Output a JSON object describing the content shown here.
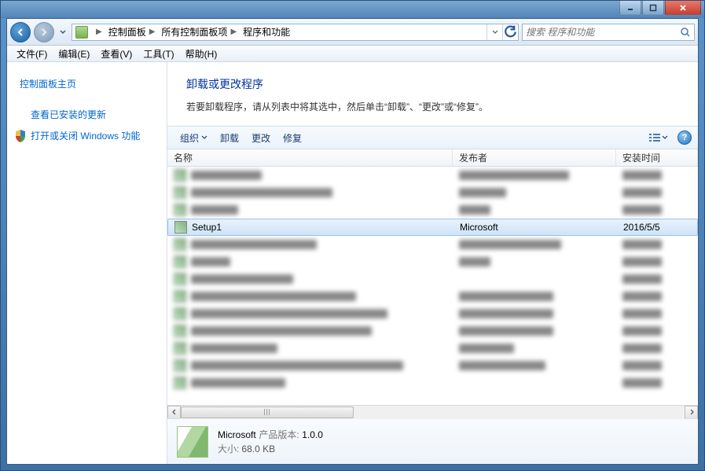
{
  "breadcrumb": {
    "root_icon_name": "control-panel",
    "items": [
      "控制面板",
      "所有控制面板项",
      "程序和功能"
    ]
  },
  "search": {
    "placeholder": "搜索 程序和功能"
  },
  "menu": {
    "file": "文件(F)",
    "edit": "编辑(E)",
    "view": "查看(V)",
    "tools": "工具(T)",
    "help": "帮助(H)"
  },
  "sidebar": {
    "home": "控制面板主页",
    "updates": "查看已安装的更新",
    "features": "打开或关闭 Windows 功能"
  },
  "heading": {
    "title": "卸载或更改程序",
    "desc": "若要卸载程序，请从列表中将其选中，然后单击“卸载”、“更改”或“修复”。"
  },
  "toolbar": {
    "organize": "组织",
    "uninstall": "卸载",
    "change": "更改",
    "repair": "修复"
  },
  "columns": {
    "name": "名称",
    "publisher": "发布者",
    "date": "安装时间"
  },
  "selected_row": {
    "name": "Setup1",
    "publisher": "Microsoft",
    "date": "2016/5/5"
  },
  "details": {
    "title": "Microsoft",
    "version_label": "产品版本:",
    "version": "1.0.0",
    "size_label": "大小:",
    "size": "68.0 KB"
  }
}
